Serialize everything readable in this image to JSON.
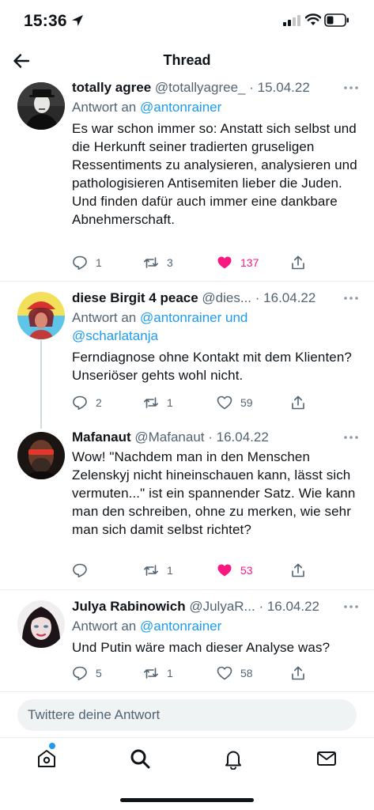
{
  "status_bar": {
    "time": "15:36"
  },
  "header": {
    "title": "Thread"
  },
  "tweets": [
    {
      "name": "totally agree",
      "handle": "@totallyagree_",
      "date": "· 15.04.22",
      "reply_prefix": "Antwort an",
      "reply_mentions": "@antonrainer",
      "reply_mentions_2": "",
      "text": "Es war schon immer so: Anstatt sich selbst und die Herkunft seiner tradierten gruseligen Ressentiments zu analysieren, analysieren und pathologisieren Antisemiten lieber die Juden. Und finden dafür auch immer eine dankbare Abnehmerschaft.",
      "replies": "1",
      "retweets": "3",
      "likes": "137",
      "liked": true
    },
    {
      "name": "diese Birgit 4 peace",
      "handle": "@dies...",
      "date": "· 16.04.22",
      "reply_prefix": "Antwort an",
      "reply_mentions": "@antonrainer und",
      "reply_mentions_2": "@scharlatanja",
      "text": "Ferndiagnose ohne Kontakt mit dem Klienten? Unseriöser gehts wohl nicht.",
      "replies": "2",
      "retweets": "1",
      "likes": "59",
      "liked": false
    },
    {
      "name": "Mafanaut",
      "handle": "@Mafanaut",
      "date": "· 16.04.22",
      "reply_prefix": "",
      "reply_mentions": "",
      "reply_mentions_2": "",
      "text": "Wow! \"Nachdem man in den Menschen Zelenskyj nicht hineinschauen kann, lässt sich vermuten...\" ist ein spannender Satz. Wie kann man den schreiben, ohne zu merken, wie sehr man sich damit selbst richtet?",
      "replies": "",
      "retweets": "1",
      "likes": "53",
      "liked": true
    },
    {
      "name": "Julya Rabinowich",
      "handle": "@JulyaR...",
      "date": "· 16.04.22",
      "reply_prefix": "Antwort an",
      "reply_mentions": "@antonrainer",
      "reply_mentions_2": "",
      "text": "Und Putin wäre mach dieser Analyse was?",
      "replies": "5",
      "retweets": "1",
      "likes": "58",
      "liked": false
    }
  ],
  "reply_bar": {
    "placeholder": "Twittere deine Antwort"
  },
  "tab_bar": {
    "items": [
      "home-icon",
      "search-icon",
      "notifications-icon",
      "messages-icon"
    ]
  },
  "colors": {
    "accent": "#1d9bf0",
    "like": "#f91880",
    "text": "#0f1419",
    "secondary": "#536471"
  }
}
